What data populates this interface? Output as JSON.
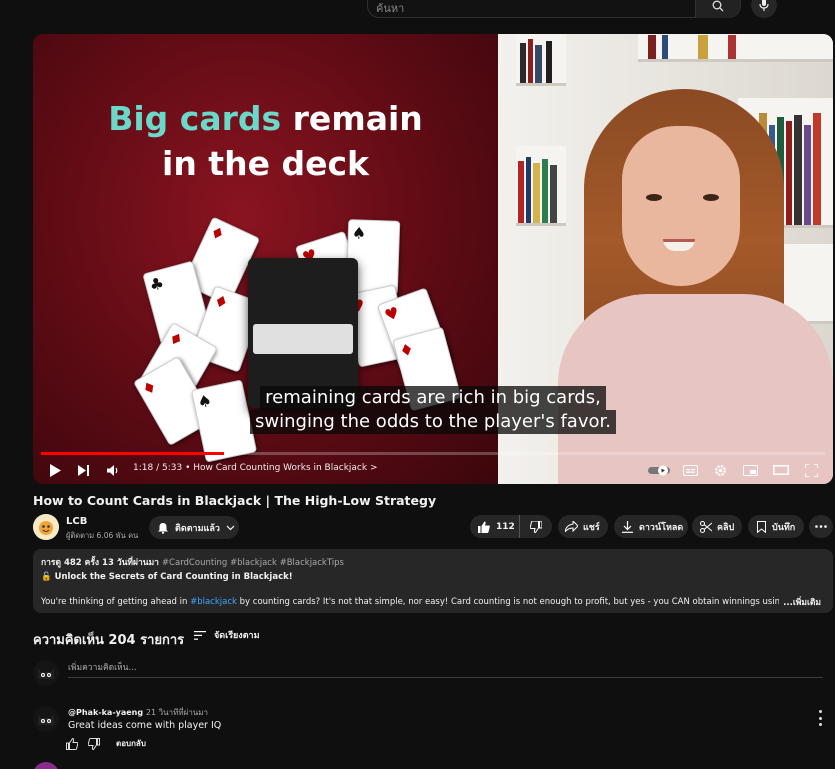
{
  "search": {
    "placeholder": "ค้นหา"
  },
  "video": {
    "slide_line1_accent": "Big cards",
    "slide_line1_rest": " remain",
    "slide_line2": "in the deck",
    "subtitle_line1": "remaining cards are rich in big cards,",
    "subtitle_line2": "swinging the odds to the player's favor.",
    "time": "1:18 / 5:33",
    "chapter": "• How Card Counting Works in Blackjack",
    "chapter_chevron": ">",
    "progress_fraction": 0.234
  },
  "title": "How to Count Cards in Blackjack | The High-Low Strategy",
  "channel": {
    "name": "LCB",
    "subscribers": "ผู้ติดตาม 6.06 พัน คน",
    "subscribed_label": "ติดตามแล้ว"
  },
  "actions": {
    "likes": "112",
    "share": "แชร์",
    "download": "ดาวน์โหลด",
    "clip": "คลิป",
    "save": "บันทึก"
  },
  "description": {
    "meta": "การดู 482 ครั้ง  13 วันที่ผ่านมา",
    "hashtags": "#CardCounting #blackjack #BlackjackTips",
    "headline": "Unlock the Secrets of Card Counting in Blackjack!",
    "body_before": "You're thinking of getting ahead in ",
    "body_link": "#blackjack",
    "body_after": " by counting cards? It's not that simple, nor easy! Card counting is not enough to profit, but yes - you CAN obtain winnings using one of many card c",
    "more": "...เพิ่มเติม"
  },
  "comments": {
    "title": "ความคิดเห็น 204 รายการ",
    "sort_label": "จัดเรียงตาม",
    "add_placeholder": "เพิ่มความคิดเห็น...",
    "items": [
      {
        "author": "@Phak-ka-yaeng",
        "time": "21 วินาทีที่ผ่านมา",
        "text": "Great ideas come with player IQ",
        "reply_label": "ตอบกลับ"
      }
    ]
  },
  "colors": {
    "accent_red": "#ff0000",
    "slide_accent": "#6ad9c9",
    "link": "#3ea6ff"
  }
}
